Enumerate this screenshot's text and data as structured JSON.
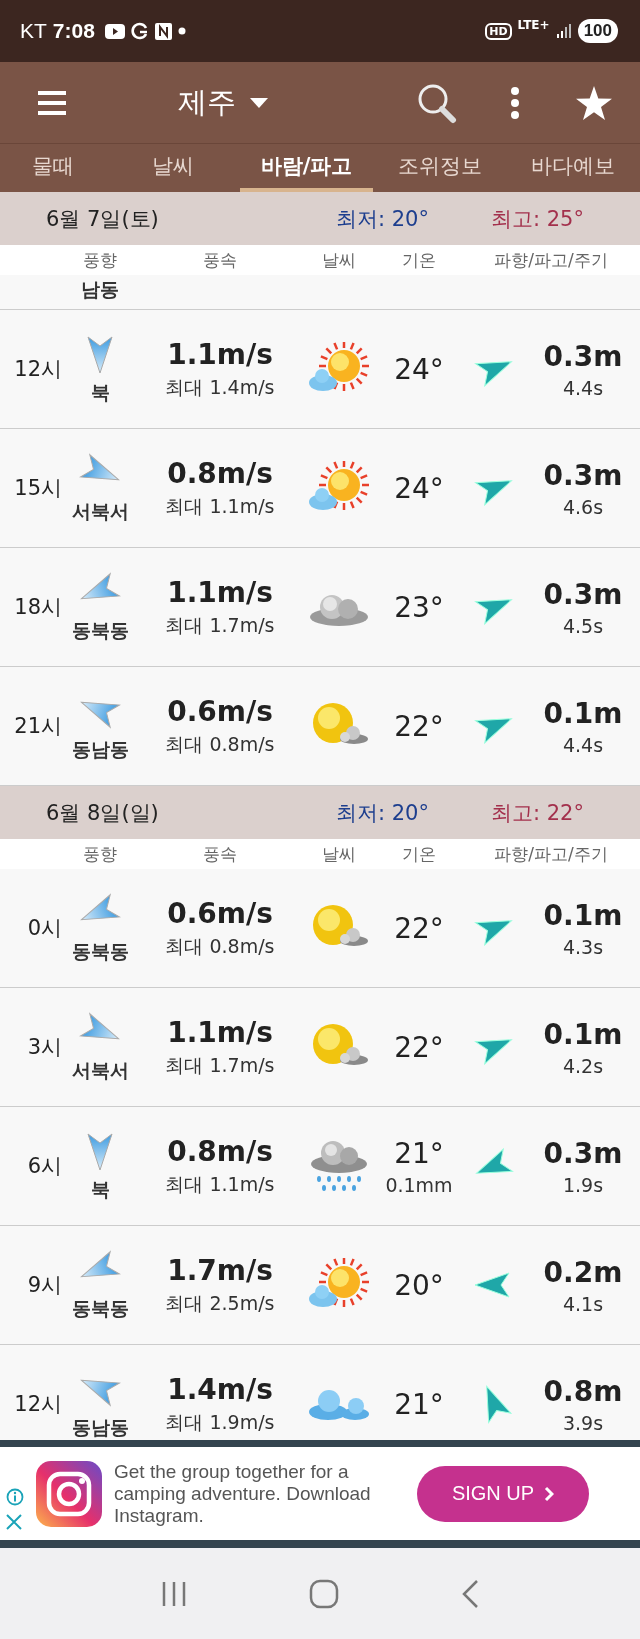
{
  "status_bar": {
    "carrier": "KT",
    "time": "7:08",
    "hd": "HD",
    "network": "LTE+",
    "battery": "100"
  },
  "toolbar": {
    "location": "제주"
  },
  "tabs": [
    {
      "label": "물때",
      "selected": false
    },
    {
      "label": "날씨",
      "selected": false
    },
    {
      "label": "바람/파고",
      "selected": true
    },
    {
      "label": "조위정보",
      "selected": false
    },
    {
      "label": "바다예보",
      "selected": false
    }
  ],
  "days": [
    {
      "date": "6월 7일(토)",
      "low": "최저: 20°",
      "high": "최고: 25°",
      "columns": [
        "풍향",
        "풍속",
        "날씨",
        "기온",
        "파향/파고/주기"
      ],
      "partial_direction": "남동",
      "rows": [
        {
          "time": "12시",
          "wind_arrow": {
            "kind": "S"
          },
          "direction": "북",
          "speed": "1.1m/s",
          "gust": "최대 1.4m/s",
          "weather": {
            "kind": "sun_cloud"
          },
          "temp": "24°",
          "wave_arrow": {
            "kind": "ENE"
          },
          "wave_height": "0.3m",
          "period": "4.4s"
        },
        {
          "time": "15시",
          "wind_arrow": {
            "kind": "ESE"
          },
          "direction": "서북서",
          "speed": "0.8m/s",
          "gust": "최대 1.1m/s",
          "weather": {
            "kind": "sun_cloud"
          },
          "temp": "24°",
          "wave_arrow": {
            "kind": "ENE"
          },
          "wave_height": "0.3m",
          "period": "4.6s"
        },
        {
          "time": "18시",
          "wind_arrow": {
            "kind": "WSW"
          },
          "direction": "동북동",
          "speed": "1.1m/s",
          "gust": "최대 1.7m/s",
          "weather": {
            "kind": "cloudy"
          },
          "temp": "23°",
          "wave_arrow": {
            "kind": "ENE"
          },
          "wave_height": "0.3m",
          "period": "4.5s"
        },
        {
          "time": "21시",
          "wind_arrow": {
            "kind": "WNW"
          },
          "direction": "동남동",
          "speed": "0.6m/s",
          "gust": "최대 0.8m/s",
          "weather": {
            "kind": "sun_small_cloud"
          },
          "temp": "22°",
          "wave_arrow": {
            "kind": "ENE"
          },
          "wave_height": "0.1m",
          "period": "4.4s"
        }
      ]
    },
    {
      "date": "6월 8일(일)",
      "low": "최저: 20°",
      "high": "최고: 22°",
      "columns": [
        "풍향",
        "풍속",
        "날씨",
        "기온",
        "파향/파고/주기"
      ],
      "rows": [
        {
          "time": "0시",
          "wind_arrow": {
            "kind": "WSW"
          },
          "direction": "동북동",
          "speed": "0.6m/s",
          "gust": "최대 0.8m/s",
          "weather": {
            "kind": "sun_small_cloud"
          },
          "temp": "22°",
          "wave_arrow": {
            "kind": "ENE"
          },
          "wave_height": "0.1m",
          "period": "4.3s"
        },
        {
          "time": "3시",
          "wind_arrow": {
            "kind": "ESE"
          },
          "direction": "서북서",
          "speed": "1.1m/s",
          "gust": "최대 1.7m/s",
          "weather": {
            "kind": "sun_small_cloud"
          },
          "temp": "22°",
          "wave_arrow": {
            "kind": "ENE"
          },
          "wave_height": "0.1m",
          "period": "4.2s"
        },
        {
          "time": "6시",
          "wind_arrow": {
            "kind": "S"
          },
          "direction": "북",
          "speed": "0.8m/s",
          "gust": "최대 1.1m/s",
          "weather": {
            "kind": "rain"
          },
          "temp": "21°",
          "precip": "0.1mm",
          "wave_arrow": {
            "kind": "WSW"
          },
          "wave_height": "0.3m",
          "period": "1.9s"
        },
        {
          "time": "9시",
          "wind_arrow": {
            "kind": "WSW"
          },
          "direction": "동북동",
          "speed": "1.7m/s",
          "gust": "최대 2.5m/s",
          "weather": {
            "kind": "sun_cloud"
          },
          "temp": "20°",
          "wave_arrow": {
            "kind": "W"
          },
          "wave_height": "0.2m",
          "period": "4.1s"
        },
        {
          "time": "12시",
          "wind_arrow": {
            "kind": "WNW"
          },
          "direction": "동남동",
          "speed": "1.4m/s",
          "gust": "최대 1.9m/s",
          "weather": {
            "kind": "clouds"
          },
          "temp": "21°",
          "wave_arrow": {
            "kind": "NNW"
          },
          "wave_height": "0.8m",
          "period": "3.9s"
        }
      ]
    }
  ],
  "ad": {
    "text": "Get the group together for a camping adventure. Download Instagram.",
    "button": "SIGN UP"
  }
}
